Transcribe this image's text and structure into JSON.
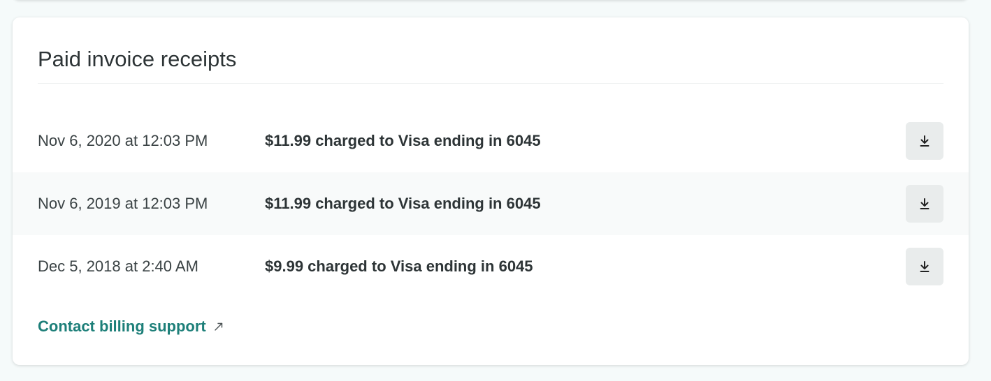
{
  "colors": {
    "accent": "#1d7f79",
    "text": "#2d3436",
    "row_alt_background": "#f8fafa",
    "button_background": "#e9ecec",
    "page_background": "#f5fafa"
  },
  "receipts_card": {
    "title": "Paid invoice receipts",
    "rows": [
      {
        "date": "Nov 6, 2020 at 12:03 PM",
        "description": "$11.99 charged to Visa ending in 6045",
        "download_icon": "download-icon"
      },
      {
        "date": "Nov 6, 2019 at 12:03 PM",
        "description": "$11.99 charged to Visa ending in 6045",
        "download_icon": "download-icon"
      },
      {
        "date": "Dec 5, 2018 at 2:40 AM",
        "description": "$9.99 charged to Visa ending in 6045",
        "download_icon": "download-icon"
      }
    ],
    "contact_link": {
      "label": "Contact billing support",
      "icon": "external-link-icon"
    }
  }
}
